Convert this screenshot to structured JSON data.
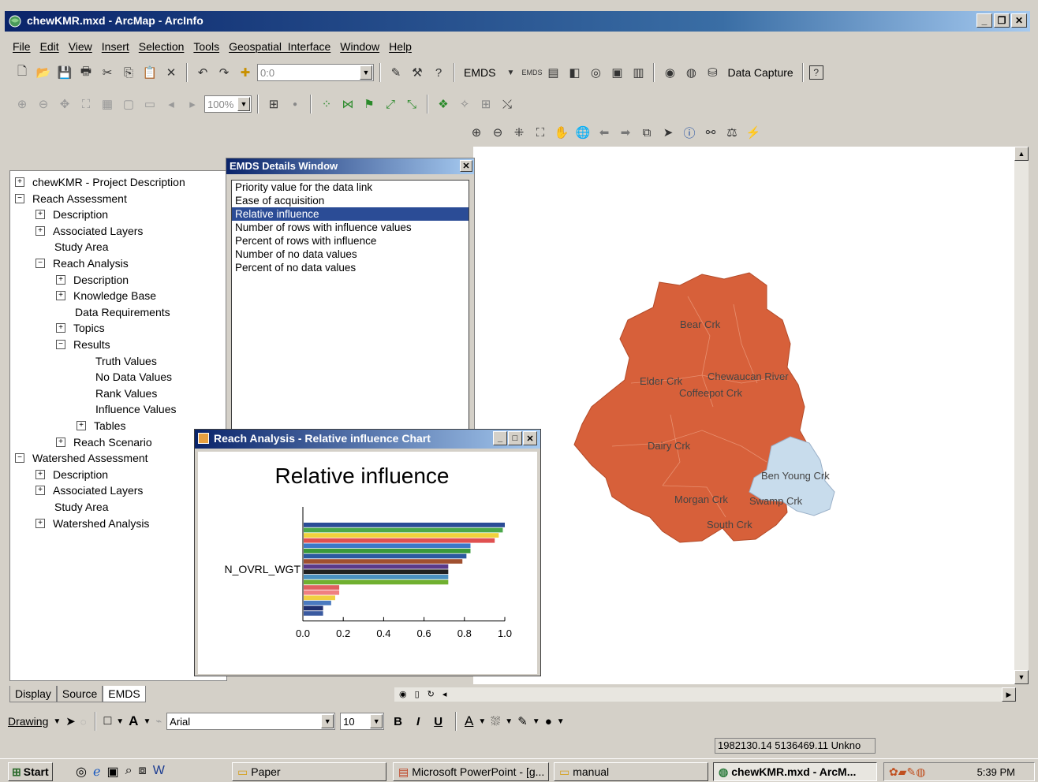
{
  "window": {
    "title": "chewKMR.mxd - ArcMap - ArcInfo"
  },
  "menu": [
    "File",
    "Edit",
    "View",
    "Insert",
    "Selection",
    "Tools",
    "Geospatial_Interface",
    "Window",
    "Help"
  ],
  "toolbar": {
    "scale_value": "0:0",
    "emds_label": "EMDS",
    "data_capture_label": "Data Capture",
    "zoom_value": "100%"
  },
  "toc": {
    "items": [
      {
        "label": "chewKMR - Project Description",
        "exp": "+"
      },
      {
        "label": "Reach Assessment",
        "exp": "-"
      },
      {
        "label": "Description",
        "exp": "+"
      },
      {
        "label": "Associated Layers",
        "exp": "+"
      },
      {
        "label": "Study Area",
        "exp": ""
      },
      {
        "label": "Reach Analysis",
        "exp": "-"
      },
      {
        "label": "Description",
        "exp": "+"
      },
      {
        "label": "Knowledge Base",
        "exp": "+"
      },
      {
        "label": "Data Requirements",
        "exp": ""
      },
      {
        "label": "Topics",
        "exp": "+"
      },
      {
        "label": "Results",
        "exp": "-"
      },
      {
        "label": "Truth Values",
        "exp": ""
      },
      {
        "label": "No Data Values",
        "exp": ""
      },
      {
        "label": "Rank Values",
        "exp": ""
      },
      {
        "label": "Influence Values",
        "exp": ""
      },
      {
        "label": "Tables",
        "exp": "+"
      },
      {
        "label": "Reach Scenario",
        "exp": "+"
      },
      {
        "label": "Watershed Assessment",
        "exp": "-"
      },
      {
        "label": "Description",
        "exp": "+"
      },
      {
        "label": "Associated Layers",
        "exp": "+"
      },
      {
        "label": "Study Area",
        "exp": ""
      },
      {
        "label": "Watershed Analysis",
        "exp": "+"
      }
    ],
    "tabs": [
      "Display",
      "Source",
      "EMDS"
    ]
  },
  "emds_window": {
    "title": "EMDS Details Window",
    "items": [
      "Priority value for the data link",
      "Ease of acquisition",
      "Relative influence",
      "Number of rows with influence values",
      "Percent of rows with influence",
      "Number of no data values",
      "Percent of no data values"
    ],
    "selected": "Relative influence"
  },
  "chart_window": {
    "title": "Reach Analysis - Relative influence Chart"
  },
  "chart_data": {
    "type": "bar",
    "orientation": "horizontal",
    "title": "Relative influence",
    "category_label": "N_OVRL_WGT",
    "xlim": [
      0.0,
      1.0
    ],
    "xticks": [
      "0.0",
      "0.2",
      "0.4",
      "0.6",
      "0.8",
      "1.0"
    ],
    "values": [
      1.0,
      0.99,
      0.97,
      0.95,
      0.83,
      0.83,
      0.81,
      0.79,
      0.72,
      0.72,
      0.72,
      0.72,
      0.18,
      0.18,
      0.16,
      0.14,
      0.1,
      0.1
    ],
    "colors": [
      "#2b4c96",
      "#4aa84a",
      "#f0d23c",
      "#e05050",
      "#3c78c8",
      "#3a9a3a",
      "#2c5aa0",
      "#a05030",
      "#5a3a8a",
      "#202020",
      "#4a90c0",
      "#70b030",
      "#e06060",
      "#f08080",
      "#f0d040",
      "#4a7ac0",
      "#203070",
      "#3a5aa0"
    ]
  },
  "map": {
    "labels": [
      "Bear Crk",
      "Elder Crk",
      "Chewaucan River",
      "Coffeepot Crk",
      "Dairy Crk",
      "Ben Young Crk",
      "Morgan Crk",
      "Swamp Crk",
      "South Crk"
    ],
    "fill_color": "#d7603a",
    "highlight_color": "#c8dcec"
  },
  "drawing_bar": {
    "drawing_label": "Drawing",
    "font_name": "Arial",
    "font_size": "10",
    "bold": "B",
    "italic": "I",
    "underline": "U"
  },
  "status": {
    "coords": "1982130.14  5136469.11 Unkno"
  },
  "taskbar": {
    "start": "Start",
    "tasks": [
      "Paper",
      "Microsoft PowerPoint - [g...",
      "manual",
      "chewKMR.mxd - ArcM..."
    ],
    "active_task": "chewKMR.mxd - ArcM...",
    "clock": "5:39 PM"
  }
}
